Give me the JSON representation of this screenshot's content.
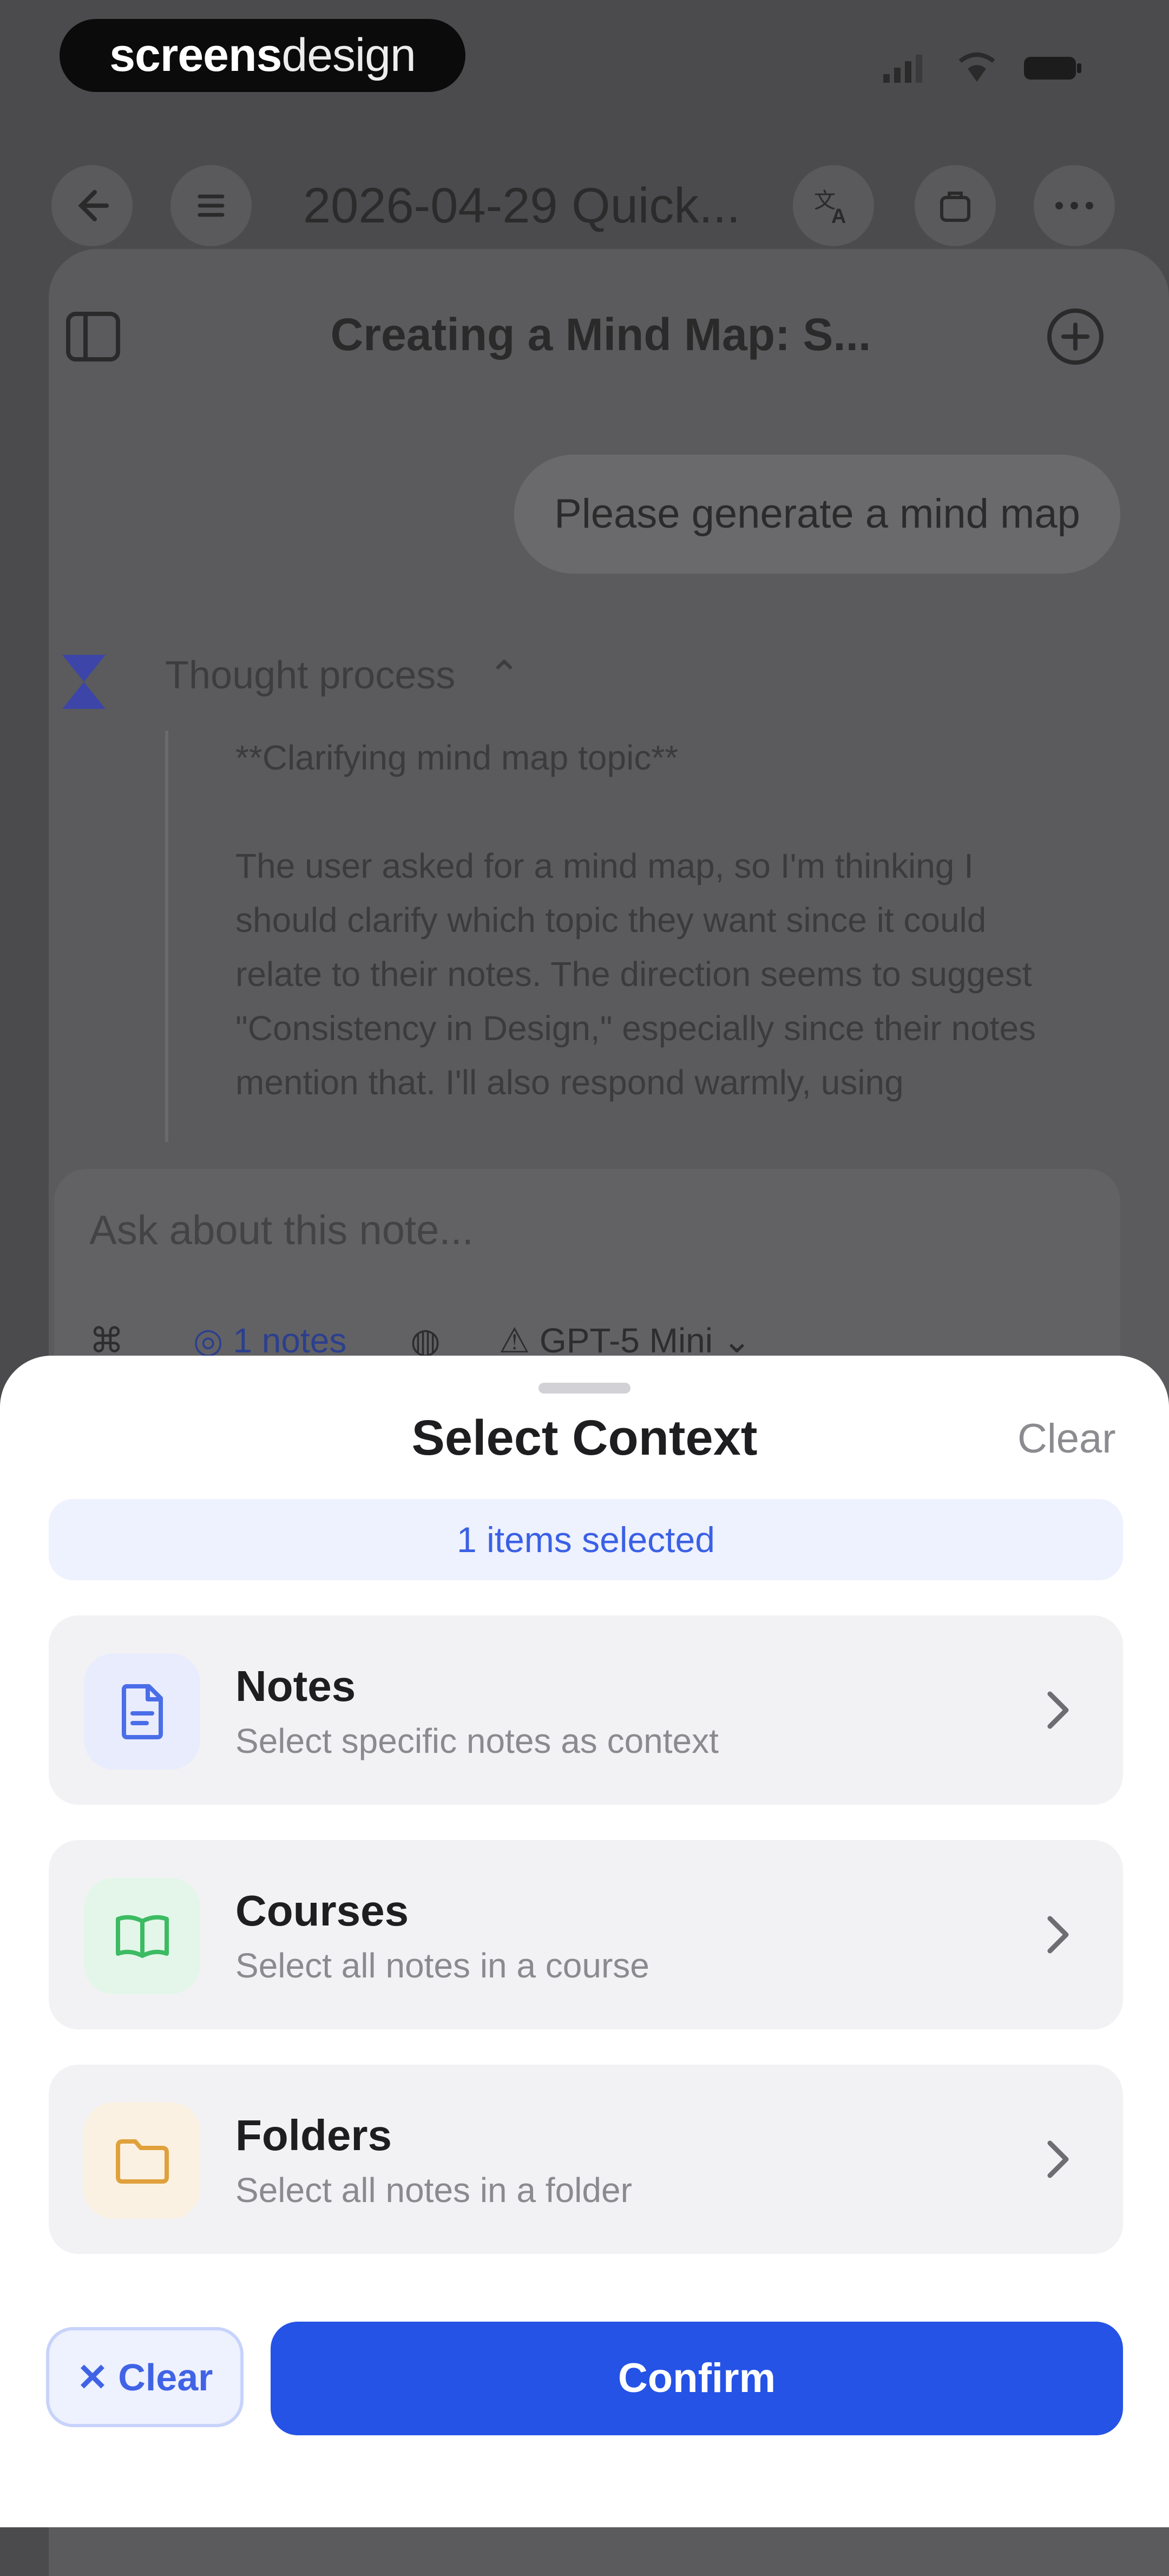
{
  "status_bar": {
    "brand_bold": "screens",
    "brand_light": "design"
  },
  "top_nav": {
    "title": "2026-04-29 Quick..."
  },
  "chat": {
    "title": "Creating a Mind Map: S...",
    "user_message": "Please generate a mind map",
    "thought_label": "Thought process",
    "thought_heading": "**Clarifying mind map topic**",
    "thought_body": "The user asked for a mind map, so I'm thinking I should clarify which topic they want since it could relate to their notes. The direction seems to suggest \"Consistency in Design,\" especially since their notes mention that. I'll also respond warmly, using mermaid diagrams formatted",
    "input_placeholder": "Ask about this note...",
    "context_label": "1 notes",
    "model_label": "GPT-5 Mini"
  },
  "sheet": {
    "title": "Select Context",
    "clear_label": "Clear",
    "selected_count": "1 items selected",
    "options": [
      {
        "title": "Notes",
        "subtitle": "Select specific notes as context",
        "icon": "document-icon",
        "tile_color": "#e9ecfd",
        "icon_color": "#4a6ee8"
      },
      {
        "title": "Courses",
        "subtitle": "Select all notes in a course",
        "icon": "book-icon",
        "tile_color": "#e4f6e9",
        "icon_color": "#3dbb63"
      },
      {
        "title": "Folders",
        "subtitle": "Select all notes in a folder",
        "icon": "folder-icon",
        "tile_color": "#fbf1e2",
        "icon_color": "#e0a13c"
      }
    ],
    "clear_button": "Clear",
    "confirm_button": "Confirm"
  },
  "colors": {
    "accent": "#2553e6",
    "dim_overlay": "#4b4b4d"
  }
}
